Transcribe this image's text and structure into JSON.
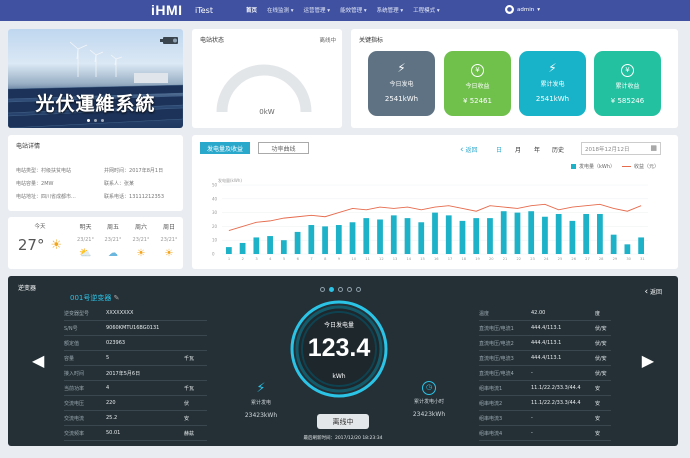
{
  "app": {
    "logo": "iHMI",
    "brand": "iTest",
    "user": "admin"
  },
  "nav": [
    "首页",
    "在线监测",
    "运营管理",
    "能效管理",
    "系统管理",
    "工程模式"
  ],
  "banner": {
    "title": "光伏運維系統"
  },
  "station_status": {
    "title": "电站状态",
    "badge": "离线中",
    "gauge_value": "0kW",
    "gauge_percent": 0
  },
  "kpi": {
    "title": "关键指标",
    "items": [
      {
        "label": "今日发电",
        "value": "2541kWh",
        "color": "#5e7283",
        "icon": "bolt-icon"
      },
      {
        "label": "今日收益",
        "value": "¥ 52461",
        "color": "#70c04c",
        "icon": "yen-icon"
      },
      {
        "label": "累计发电",
        "value": "2541kWh",
        "color": "#19b3c9",
        "icon": "bolt-icon"
      },
      {
        "label": "累计收益",
        "value": "¥ 585246",
        "color": "#23c1a0",
        "icon": "yen-icon"
      }
    ]
  },
  "detail": {
    "title": "电站详情",
    "fields": [
      {
        "k": "电站类型：",
        "v": "村级扶贫电站",
        "k2": "并网时间：",
        "v2": "2017年8月1日"
      },
      {
        "k": "电站容量：",
        "v": "2MW",
        "k2": "联系人：",
        "v2": "张某"
      },
      {
        "k": "电站地址：",
        "v": "四川省成都市...",
        "k2": "联系电话：",
        "v2": "13111212353"
      }
    ]
  },
  "weather": [
    {
      "day": "今天",
      "temp": "27°",
      "icon": "sun-icon"
    },
    {
      "day": "明天",
      "temp": "23/21°",
      "icon": "cloud-sun-icon"
    },
    {
      "day": "周五",
      "temp": "23/21°",
      "icon": "cloud-icon"
    },
    {
      "day": "周六",
      "temp": "23/21°",
      "icon": "sun-icon"
    },
    {
      "day": "周日",
      "temp": "23/21°",
      "icon": "sun-icon"
    }
  ],
  "chart_panel": {
    "tab_active": "发电量及收益",
    "tab_inactive": "功率曲线",
    "back": "返回",
    "filters": [
      "日",
      "月",
      "年",
      "历史"
    ],
    "date_placeholder": "2018年12月12日",
    "legend": [
      "发电量（kWh）",
      "收益（元）"
    ],
    "ylabel": "发电量(kWh)"
  },
  "chart_data": {
    "type": "bar",
    "categories": [
      "1",
      "2",
      "3",
      "4",
      "5",
      "6",
      "7",
      "8",
      "9",
      "10",
      "11",
      "12",
      "13",
      "14",
      "15",
      "16",
      "17",
      "18",
      "19",
      "20",
      "21",
      "22",
      "23",
      "24",
      "25",
      "26",
      "27",
      "28",
      "29",
      "30",
      "31"
    ],
    "series": [
      {
        "name": "发电量（kWh）",
        "type": "bar",
        "values": [
          5,
          8,
          12,
          13,
          10,
          16,
          21,
          20,
          21,
          23,
          26,
          25,
          28,
          26,
          23,
          30,
          28,
          24,
          26,
          26,
          31,
          30,
          31,
          27,
          29,
          24,
          29,
          29,
          14,
          7,
          12
        ]
      },
      {
        "name": "收益（元）",
        "type": "line",
        "values": [
          17,
          20,
          23,
          24,
          26,
          27,
          28,
          27,
          30,
          33,
          32,
          34,
          33,
          34,
          32,
          34,
          35,
          33,
          31,
          35,
          34,
          33,
          35,
          36,
          32,
          34,
          35,
          36,
          33,
          31,
          35
        ]
      }
    ],
    "ylim": [
      0,
      50
    ],
    "yticks": [
      0,
      10,
      20,
      30,
      40,
      50
    ]
  },
  "inverter": {
    "title": "逆变器",
    "name": "001号逆变器",
    "back": "返回",
    "left_rows": [
      {
        "k": "逆变器型号",
        "v": "XXXXXXXX",
        "u": ""
      },
      {
        "k": "S/N号",
        "v": "9060KMTU16BG0131",
        "u": ""
      },
      {
        "k": "额定值",
        "v": "023963",
        "u": ""
      },
      {
        "k": "容量",
        "v": "5",
        "u": "千瓦"
      },
      {
        "k": "接入时间",
        "v": "2017年5月6日",
        "u": ""
      },
      {
        "k": "当前功率",
        "v": "4",
        "u": "千瓦"
      },
      {
        "k": "交流电压",
        "v": "220",
        "u": "伏"
      },
      {
        "k": "交流电流",
        "v": "25.2",
        "u": "安"
      },
      {
        "k": "交流频率",
        "v": "50.01",
        "u": "赫兹"
      }
    ],
    "today_label": "今日发电量",
    "today_value": "123.4",
    "today_unit": "kWh",
    "total_label": "累计发电",
    "total_value": "23423kWh",
    "hours_label": "累计发电小时",
    "hours_value": "23423kWh",
    "status": "离线中",
    "updated": "最后刷新时间：2017/12/20 18:23:34",
    "right_rows": [
      {
        "k": "温度",
        "v": "42.00",
        "u": "度"
      },
      {
        "k": "直流电压/电流1",
        "v": "444.4/113.1",
        "u": "伏/安"
      },
      {
        "k": "直流电压/电流2",
        "v": "444.4/113.1",
        "u": "伏/安"
      },
      {
        "k": "直流电压/电流3",
        "v": "444.4/113.1",
        "u": "伏/安"
      },
      {
        "k": "直流电压/电流4",
        "v": "-",
        "u": "伏/安"
      },
      {
        "k": "组串电流1",
        "v": "11.1/22.2/33.3/44.4",
        "u": "安"
      },
      {
        "k": "组串电流2",
        "v": "11.1/22.2/33.3/44.4",
        "u": "安"
      },
      {
        "k": "组串电流3",
        "v": "-",
        "u": "安"
      },
      {
        "k": "组串电流4",
        "v": "-",
        "u": "安"
      }
    ]
  }
}
